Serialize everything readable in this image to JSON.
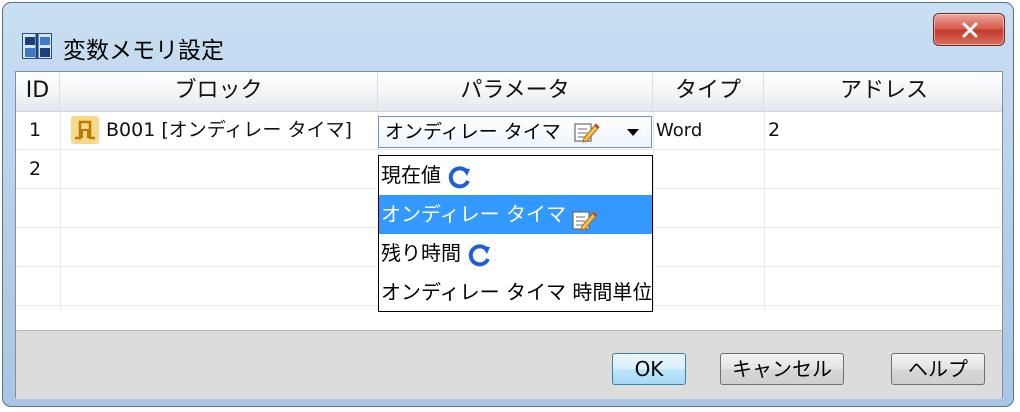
{
  "window": {
    "title": "変数メモリ設定",
    "close_label": "X"
  },
  "table": {
    "headers": [
      "ID",
      "ブロック",
      "パラメータ",
      "タイプ",
      "アドレス"
    ],
    "rows": [
      {
        "id": "1",
        "block": "B001 [オンディレー タイマ]",
        "parameter": "オンディレー タイマ",
        "type": "Word",
        "address": "2"
      },
      {
        "id": "2",
        "block": "",
        "parameter": "",
        "type": "",
        "address": ""
      }
    ]
  },
  "dropdown": {
    "selected_index": 1,
    "options": [
      {
        "label": "現在値",
        "icon": "refresh-icon"
      },
      {
        "label": "オンディレー タイマ",
        "icon": "edit-icon"
      },
      {
        "label": "残り時間",
        "icon": "refresh-icon"
      },
      {
        "label": "オンディレー タイマ 時間単位",
        "icon": ""
      }
    ]
  },
  "buttons": {
    "ok": "OK",
    "cancel": "キャンセル",
    "help": "ヘルプ"
  },
  "colors": {
    "selection": "#3399ff",
    "block_icon": "#f7d98a",
    "close_button": "#c23a2c"
  }
}
